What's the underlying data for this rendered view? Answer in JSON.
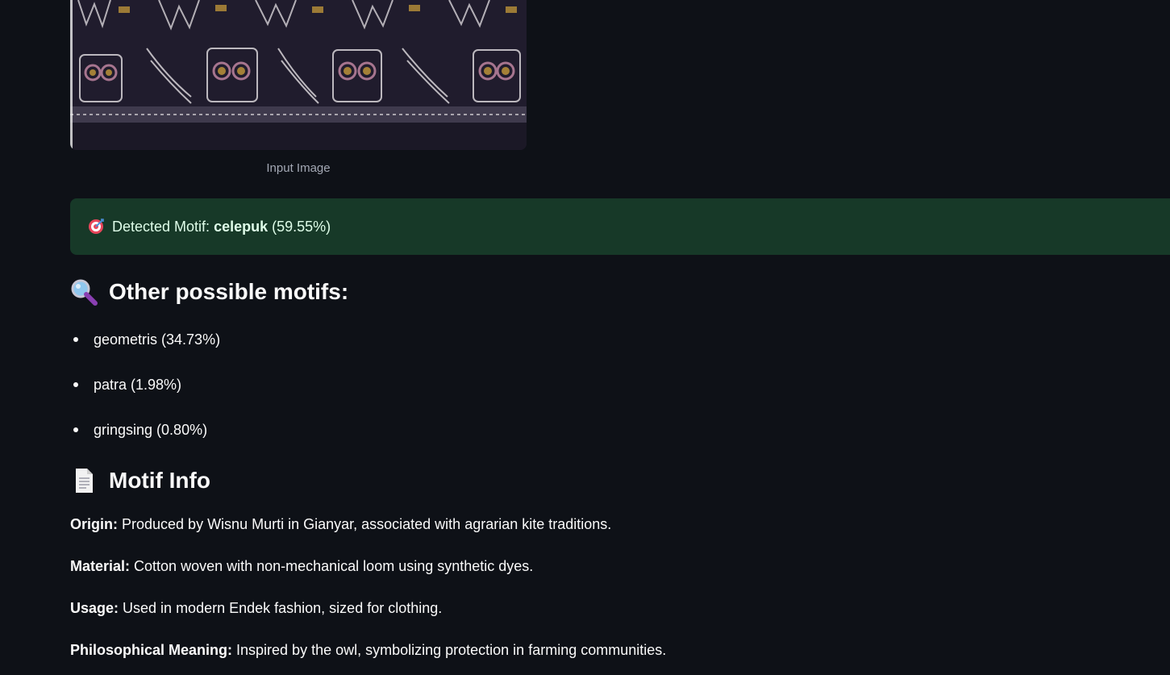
{
  "image": {
    "caption": "Input Image",
    "colors": {
      "background": "#1f1b2b",
      "motif_light": "#d8d4d8",
      "motif_gold": "#c69a3a",
      "motif_pink": "#c98ca8"
    }
  },
  "detection": {
    "icon": "target-icon",
    "prefix": "Detected Motif: ",
    "motif": "celepuk",
    "confidence": " (59.55%)"
  },
  "other_motifs": {
    "icon": "magnifier-icon",
    "heading": "Other possible motifs:",
    "items": [
      {
        "label": "geometris (34.73%)"
      },
      {
        "label": "patra (1.98%)"
      },
      {
        "label": "gringsing (0.80%)"
      }
    ]
  },
  "motif_info": {
    "icon": "document-icon",
    "heading": "Motif Info",
    "origin_label": "Origin:",
    "origin_text": " Produced by Wisnu Murti in Gianyar, associated with agrarian kite traditions.",
    "material_label": "Material:",
    "material_text": " Cotton woven with non-mechanical loom using synthetic dyes.",
    "usage_label": "Usage:",
    "usage_text": " Used in modern Endek fashion, sized for clothing.",
    "meaning_label": "Philosophical Meaning:",
    "meaning_text": " Inspired by the owl, symbolizing protection in farming communities."
  },
  "colors": {
    "page_bg": "#0e1117",
    "success_bg": "#173928",
    "success_text": "#dffde9",
    "caption_text": "#a3a8b4"
  }
}
